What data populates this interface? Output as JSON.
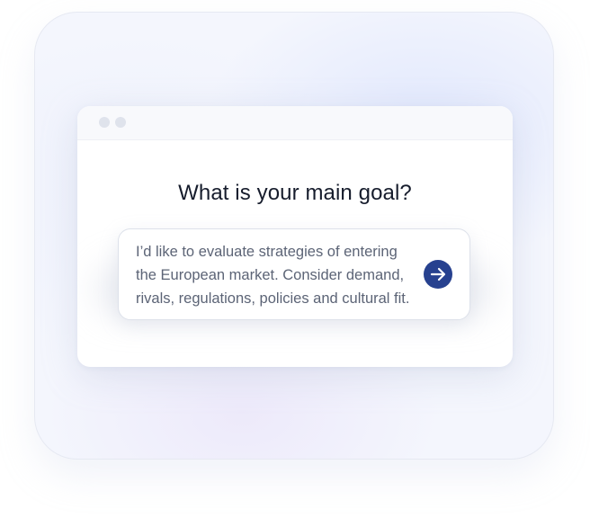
{
  "prompt": {
    "question": "What is your main goal?",
    "input_value": "I’d like to evaluate strategies of entering\nthe European market. Consider demand,\nrivals, regulations, policies and cultural fit.",
    "send_icon": "arrow-right-icon"
  },
  "colors": {
    "accent": "#27418f",
    "question_text": "#161c2c",
    "input_text": "#5c6476"
  }
}
